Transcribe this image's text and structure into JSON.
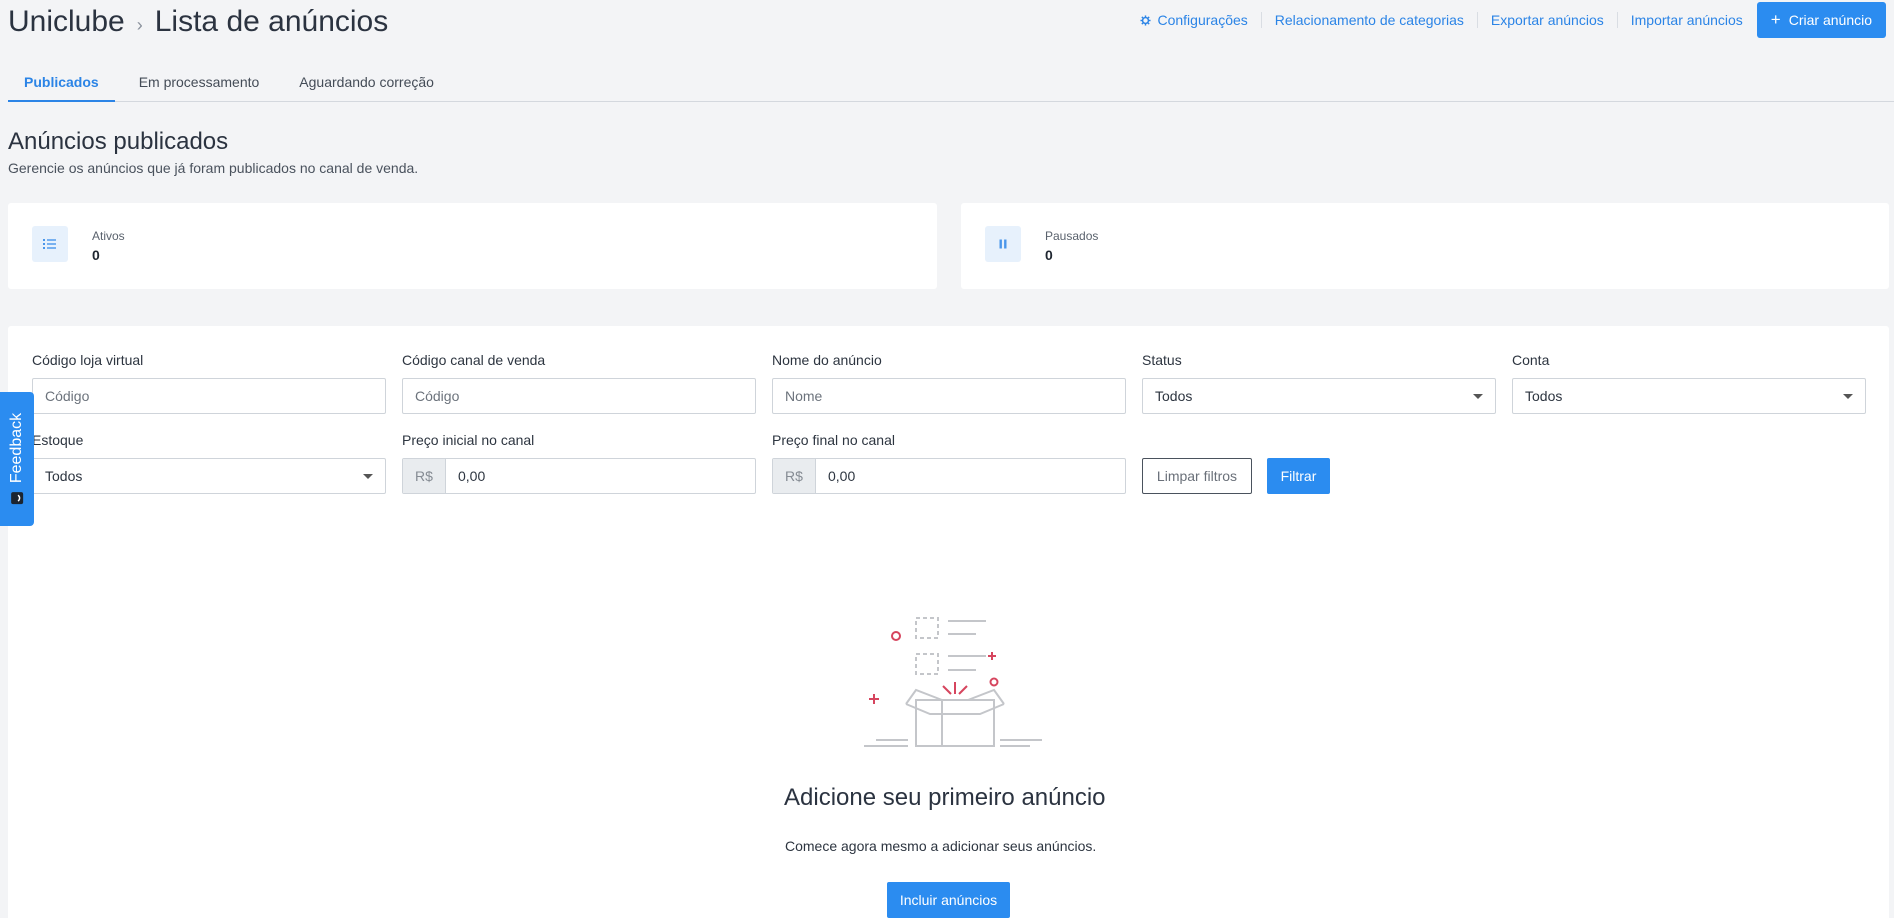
{
  "breadcrumb": {
    "root": "Uniclube",
    "separator": "›",
    "current": "Lista de anúncios"
  },
  "header_actions": {
    "settings": "Configurações",
    "categories": "Relacionamento de categorias",
    "export": "Exportar anúncios",
    "import": "Importar anúncios",
    "create": "Criar anúncio",
    "create_icon": "+"
  },
  "tabs": [
    {
      "label": "Publicados",
      "active": true
    },
    {
      "label": "Em processamento",
      "active": false
    },
    {
      "label": "Aguardando correção",
      "active": false
    }
  ],
  "page": {
    "title": "Anúncios publicados",
    "subtitle": "Gerencie os anúncios que já foram publicados no canal de venda."
  },
  "stats": {
    "active": {
      "label": "Ativos",
      "value": "0",
      "icon": "list-icon"
    },
    "paused": {
      "label": "Pausados",
      "value": "0",
      "icon": "pause-icon"
    }
  },
  "filters": {
    "store_code": {
      "label": "Código loja virtual",
      "placeholder": "Código"
    },
    "channel_code": {
      "label": "Código canal de venda",
      "placeholder": "Código"
    },
    "ad_name": {
      "label": "Nome do anúncio",
      "placeholder": "Nome"
    },
    "status": {
      "label": "Status",
      "value": "Todos"
    },
    "account": {
      "label": "Conta",
      "value": "Todos"
    },
    "stock": {
      "label": "Estoque",
      "value": "Todos"
    },
    "price_start": {
      "label": "Preço inicial no canal",
      "prefix": "R$",
      "value": "0,00"
    },
    "price_end": {
      "label": "Preço final no canal",
      "prefix": "R$",
      "value": "0,00"
    },
    "clear": "Limpar filtros",
    "apply": "Filtrar"
  },
  "empty_state": {
    "title": "Adicione seu primeiro anúncio",
    "subtitle": "Comece agora mesmo a adicionar seus anúncios.",
    "button": "Incluir anúncios"
  },
  "feedback": {
    "label": "Feedback"
  },
  "colors": {
    "accent": "#2b8cf0",
    "illustration_accent": "#d6455e"
  }
}
